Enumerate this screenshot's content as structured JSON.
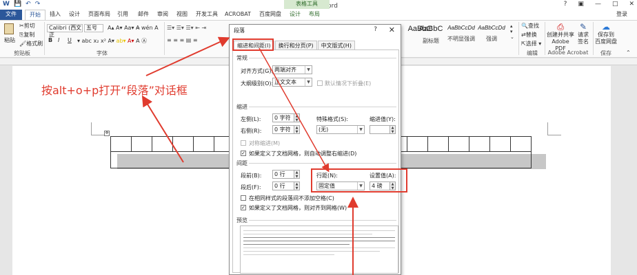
{
  "app": {
    "title": "文档2 - Word",
    "context_tab_group": "表格工具",
    "login": "登录"
  },
  "qat": {
    "save": "💾",
    "undo": "↶",
    "redo": "↷"
  },
  "window_controls": {
    "help": "?",
    "restore": "▣",
    "minimize": "—",
    "maximize": "□",
    "close": "✕"
  },
  "tabs": [
    {
      "label": "文件"
    },
    {
      "label": "开始"
    },
    {
      "label": "插入"
    },
    {
      "label": "设计"
    },
    {
      "label": "页面布局"
    },
    {
      "label": "引用"
    },
    {
      "label": "邮件"
    },
    {
      "label": "审阅"
    },
    {
      "label": "视图"
    },
    {
      "label": "开发工具"
    },
    {
      "label": "ACROBAT"
    },
    {
      "label": "百度网盘"
    },
    {
      "label": "设计"
    },
    {
      "label": "布局"
    }
  ],
  "ribbon": {
    "clipboard": {
      "paste": "粘贴",
      "cut": "剪切",
      "copy": "复制",
      "format_painter": "格式刷",
      "group": "剪贴板"
    },
    "font": {
      "name": "Calibri (西文正",
      "size": "五号",
      "group": "字体",
      "bold": "B",
      "italic": "I",
      "underline": "U"
    },
    "styles": [
      {
        "sample": "AaBbC",
        "name": ""
      },
      {
        "sample": "AaBbC",
        "name": "副标题"
      },
      {
        "sample": "AaBbCcDd",
        "name": "不明显强调"
      },
      {
        "sample": "AaBbCcDd",
        "name": "强调"
      }
    ],
    "editing": {
      "find": "查找",
      "replace": "替换",
      "select": "选择 ▾",
      "group": "编辑"
    },
    "acrobat": {
      "create_share": "创建并共享",
      "pdf": "Adobe PDF",
      "request_sign": "请求",
      "sign": "签名",
      "group": "Adobe Acrobat"
    },
    "save": {
      "save_to": "保存到",
      "baidu": "百度网盘",
      "group": "保存"
    }
  },
  "annotation": "按alt+o+p打开“段落”对话框",
  "dialog": {
    "title": "段落",
    "help": "?",
    "close": "✕",
    "tabs": [
      {
        "label": "缩进和间距(I)"
      },
      {
        "label": "换行和分页(P)"
      },
      {
        "label": "中文版式(H)"
      }
    ],
    "general": {
      "section": "常规",
      "alignment_label": "对齐方式(G):",
      "alignment_value": "两端对齐",
      "outline_label": "大纲级别(O):",
      "outline_value": "正文文本",
      "collapsed_label": "默认情况下折叠(E)"
    },
    "indent": {
      "section": "缩进",
      "left_label": "左侧(L):",
      "left_value": "0 字符",
      "right_label": "右侧(R):",
      "right_value": "0 字符",
      "special_label": "特殊格式(S):",
      "special_value": "(无)",
      "by_label": "缩进值(Y):",
      "by_value": "",
      "mirror_label": "对称缩进(M)",
      "grid_label": "如果定义了文档网格，则自动调整右缩进(D)"
    },
    "spacing": {
      "section": "间距",
      "before_label": "段前(B):",
      "before_value": "0 行",
      "after_label": "段后(F):",
      "after_value": "0 行",
      "line_label": "行距(N):",
      "line_value": "固定值",
      "at_label": "设置值(A):",
      "at_value": "4 磅",
      "no_space_label": "在相同样式的段落间不添加空格(C)",
      "snap_grid_label": "如果定义了文档网格，则对齐到网格(W)"
    },
    "preview": {
      "section": "预览"
    }
  },
  "colors": {
    "accent": "#2b579a",
    "annotation_red": "#e03b2e"
  }
}
